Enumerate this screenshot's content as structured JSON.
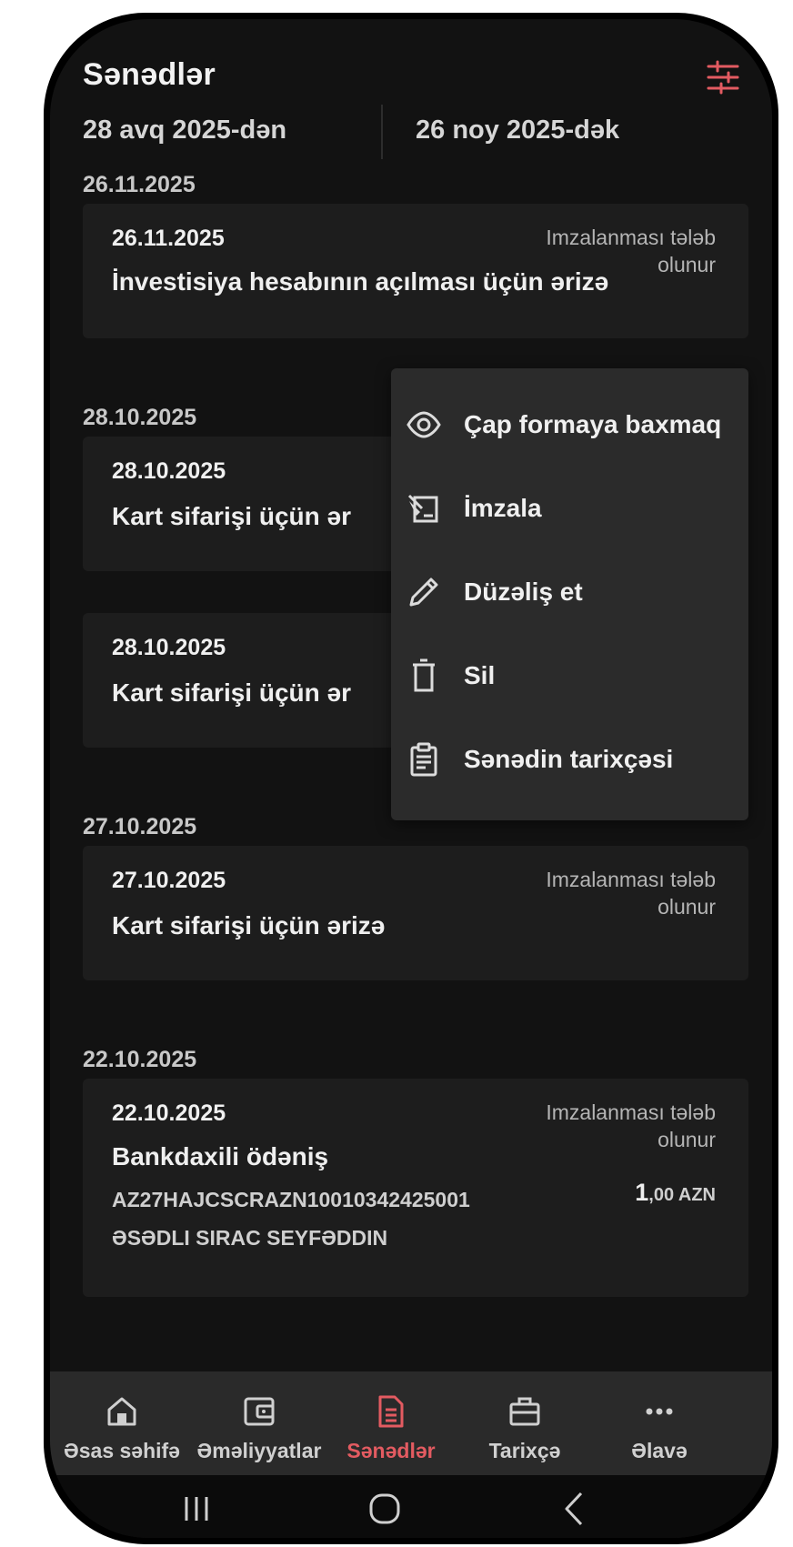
{
  "header": {
    "title": "Sənədlər"
  },
  "date_range": {
    "from": "28 avq 2025-dən",
    "to": "26 noy 2025-dək"
  },
  "groups": [
    {
      "date": "26.11.2025"
    },
    {
      "date": "28.10.2025"
    },
    {
      "date": "27.10.2025"
    },
    {
      "date": "22.10.2025"
    }
  ],
  "cards": [
    {
      "date": "26.11.2025",
      "status": "Imzalanması tələb olunur",
      "title": "İnvestisiya hesabının açılması üçün ərizə"
    },
    {
      "date": "28.10.2025",
      "title": "Kart sifarişi üçün ər"
    },
    {
      "date": "28.10.2025",
      "title": "Kart sifarişi üçün ər"
    },
    {
      "date": "27.10.2025",
      "status": "Imzalanması tələb olunur",
      "title": "Kart sifarişi üçün ərizə"
    },
    {
      "date": "22.10.2025",
      "status": "Imzalanması tələb olunur",
      "title": "Bankdaxili ödəniş",
      "account": "AZ27HAJCSCRAZN10010342425001",
      "name": "ƏSƏDLI SIRAC SEYFƏDDIN",
      "amount_int": "1",
      "amount_rest": ",00 AZN"
    }
  ],
  "context_menu": {
    "items": [
      {
        "label": "Çap formaya baxmaq",
        "icon": "eye-icon"
      },
      {
        "label": "İmzala",
        "icon": "sign-icon"
      },
      {
        "label": "Düzəliş et",
        "icon": "pencil-icon"
      },
      {
        "label": "Sil",
        "icon": "trash-icon"
      },
      {
        "label": "Sənədin tarixçəsi",
        "icon": "clipboard-icon"
      }
    ]
  },
  "bottom_nav": {
    "items": [
      {
        "label": "Əsas səhifə",
        "icon": "home-icon",
        "active": false
      },
      {
        "label": "Əməliyyatlar",
        "icon": "wallet-icon",
        "active": false
      },
      {
        "label": "Sənədlər",
        "icon": "document-icon",
        "active": true
      },
      {
        "label": "Tarixçə",
        "icon": "briefcase-icon",
        "active": false
      },
      {
        "label": "Əlavə",
        "icon": "more-icon",
        "active": false
      }
    ]
  },
  "system_nav": {
    "buttons": [
      "recent-apps-icon",
      "home-circle-icon",
      "back-icon"
    ]
  },
  "colors": {
    "accent": "#e35b61",
    "background": "#121212",
    "card": "#1d1d1d",
    "menu": "#2b2b2b",
    "nav": "#2a2a2a"
  }
}
